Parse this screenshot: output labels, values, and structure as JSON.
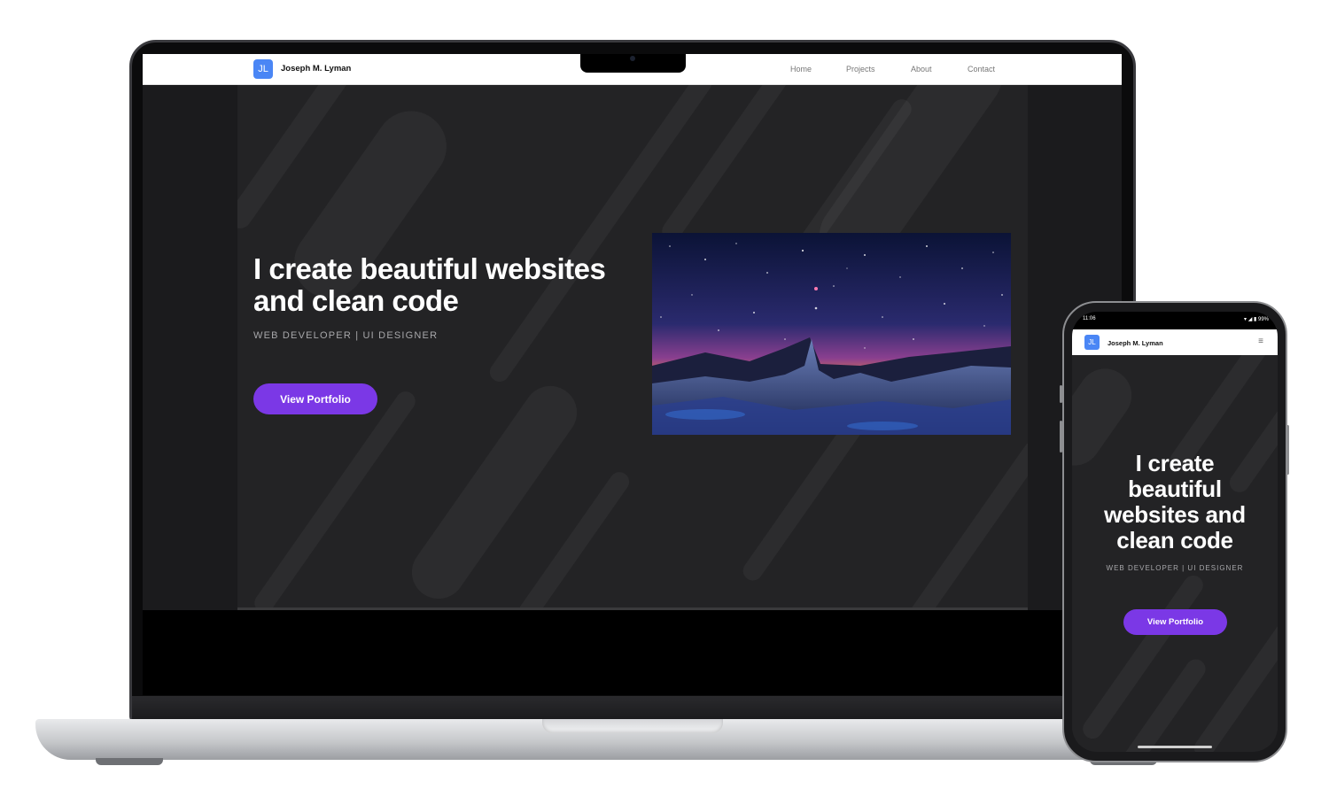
{
  "desktop": {
    "logo_text": "JL",
    "brand": "Joseph M. Lyman",
    "nav": [
      "Home",
      "Projects",
      "About",
      "Contact"
    ],
    "hero_title": "I create beautiful websites and clean code",
    "hero_subtitle": "WEB DEVELOPER | UI DESIGNER",
    "cta": "View Portfolio"
  },
  "mobile": {
    "status_time": "11:06",
    "status_battery": "99%",
    "logo_text": "JL",
    "brand": "Joseph M. Lyman",
    "menu_icon": "≡",
    "hero_title": "I create beautiful websites and clean code",
    "hero_subtitle": "WEB DEVELOPER | UI DESIGNER",
    "cta": "View Portfolio"
  },
  "colors": {
    "accent": "#7b38e6",
    "logo_blue": "#4a86f5",
    "hero_bg": "#232325"
  },
  "icons": [
    "hamburger-menu-icon",
    "camera-icon",
    "wifi-icon",
    "signal-icon",
    "battery-icon"
  ]
}
